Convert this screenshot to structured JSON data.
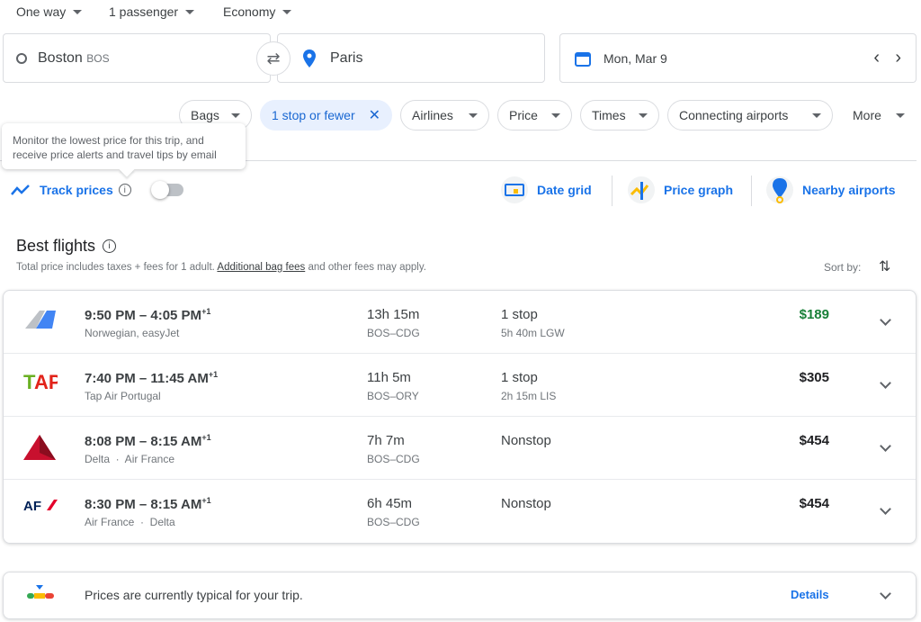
{
  "top": {
    "trip_type": "One way",
    "passengers": "1 passenger",
    "cabin": "Economy"
  },
  "search": {
    "origin": "Boston",
    "origin_code": "BOS",
    "destination": "Paris",
    "date": "Mon, Mar 9"
  },
  "filters": [
    {
      "label": "Bags"
    },
    {
      "label": "1 stop or fewer",
      "active": true
    },
    {
      "label": "Airlines"
    },
    {
      "label": "Price"
    },
    {
      "label": "Times"
    },
    {
      "label": "Connecting airports"
    },
    {
      "label": "More"
    }
  ],
  "tooltip": "Monitor the lowest price for this trip, and receive price alerts and travel tips by email",
  "track": {
    "label": "Track prices",
    "enabled": false
  },
  "tools": {
    "date_grid": "Date grid",
    "price_graph": "Price graph",
    "nearby": "Nearby airports"
  },
  "best": {
    "title": "Best flights",
    "subtitle_pre": "Total price includes taxes + fees for 1 adult. ",
    "bag_link": "Additional bag fees",
    "subtitle_post": " and other fees may apply.",
    "sort_label": "Sort by:"
  },
  "flights": [
    {
      "times": "9:50 PM – 4:05 PM",
      "plus": "+1",
      "airlines": "Norwegian, easyJet",
      "duration": "13h 15m",
      "route": "BOS–CDG",
      "stops": "1 stop",
      "layover": "5h 40m LGW",
      "price": "$189",
      "price_color": "#188038"
    },
    {
      "times": "7:40 PM – 11:45 AM",
      "plus": "+1",
      "airlines": "Tap Air Portugal",
      "duration": "11h 5m",
      "route": "BOS–ORY",
      "stops": "1 stop",
      "layover": "2h 15m LIS",
      "price": "$305",
      "price_color": "#202124"
    },
    {
      "times": "8:08 PM – 8:15 AM",
      "plus": "+1",
      "airlines": "Delta  ·  Air France",
      "duration": "7h 7m",
      "route": "BOS–CDG",
      "stops": "Nonstop",
      "layover": "",
      "price": "$454",
      "price_color": "#202124"
    },
    {
      "times": "8:30 PM – 8:15 AM",
      "plus": "+1",
      "airlines": "Air France  ·  Delta",
      "duration": "6h 45m",
      "route": "BOS–CDG",
      "stops": "Nonstop",
      "layover": "",
      "price": "$454",
      "price_color": "#202124"
    }
  ],
  "insight": {
    "text": "Prices are currently typical for your trip.",
    "details": "Details"
  }
}
